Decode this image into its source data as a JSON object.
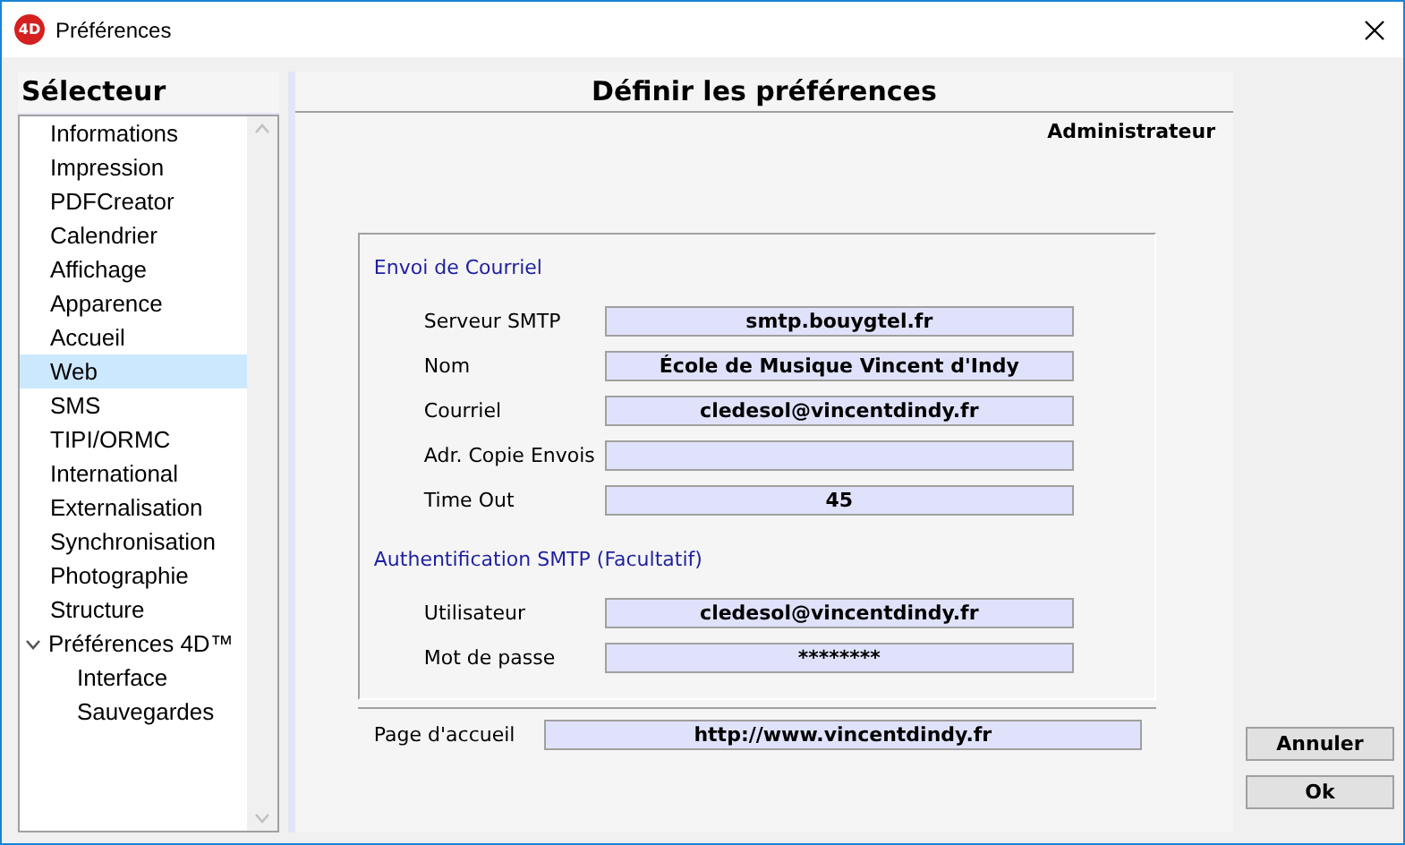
{
  "window": {
    "title": "Préférences",
    "logo_text": "4D"
  },
  "sidebar": {
    "title": "Sélecteur",
    "items": [
      {
        "label": "Informations",
        "selected": false
      },
      {
        "label": "Impression",
        "selected": false
      },
      {
        "label": "PDFCreator",
        "selected": false
      },
      {
        "label": "Calendrier",
        "selected": false
      },
      {
        "label": "Affichage",
        "selected": false
      },
      {
        "label": "Apparence",
        "selected": false
      },
      {
        "label": "Accueil",
        "selected": false
      },
      {
        "label": "Web",
        "selected": true
      },
      {
        "label": "SMS",
        "selected": false
      },
      {
        "label": "TIPI/ORMC",
        "selected": false
      },
      {
        "label": "International",
        "selected": false
      },
      {
        "label": "Externalisation",
        "selected": false
      },
      {
        "label": "Synchronisation",
        "selected": false
      },
      {
        "label": "Photographie",
        "selected": false
      },
      {
        "label": "Structure",
        "selected": false
      },
      {
        "label": "Préférences 4D™",
        "selected": false,
        "expanded": true,
        "children": [
          {
            "label": "Interface",
            "selected": false
          },
          {
            "label": "Sauvegardes",
            "selected": false
          }
        ]
      }
    ]
  },
  "panel": {
    "title": "Définir les préférences",
    "user": "Administrateur",
    "groups": [
      {
        "title": "Envoi de Courriel",
        "fields": [
          {
            "label": "Serveur SMTP",
            "value": "smtp.bouygtel.fr"
          },
          {
            "label": "Nom",
            "value": "École de Musique Vincent d'Indy"
          },
          {
            "label": "Courriel",
            "value": "cledesol@vincentdindy.fr"
          },
          {
            "label": "Adr. Copie Envois"
          },
          {
            "label": "Time Out",
            "value": "45"
          }
        ]
      },
      {
        "title": "Authentification SMTP (Facultatif)",
        "fields": [
          {
            "label": "Utilisateur",
            "value": "cledesol@vincentdindy.fr"
          },
          {
            "label": "Mot de passe",
            "value": "********"
          }
        ]
      }
    ],
    "homepage": {
      "label": "Page d'accueil",
      "value": "http://www.vincentdindy.fr"
    }
  },
  "buttons": [
    "Annuler",
    "Ok"
  ]
}
